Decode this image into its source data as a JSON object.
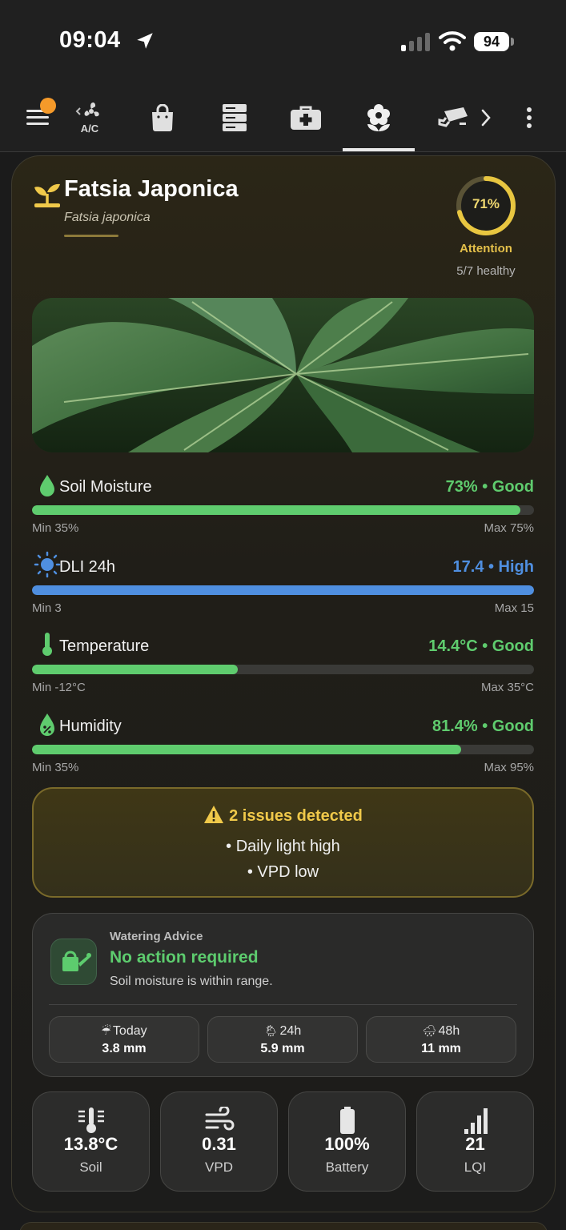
{
  "status_bar": {
    "time": "09:04",
    "battery": "94"
  },
  "tabs": [
    {
      "name": "menu",
      "icon": "hamburger-menu-icon"
    },
    {
      "name": "ac",
      "icon": "fan-icon",
      "label": "A/C"
    },
    {
      "name": "shopping",
      "icon": "shopping-bag-icon"
    },
    {
      "name": "server",
      "icon": "server-rack-icon"
    },
    {
      "name": "medical",
      "icon": "first-aid-kit-icon"
    },
    {
      "name": "plants",
      "icon": "flower-icon",
      "active": true
    },
    {
      "name": "cameras",
      "icon": "security-camera-icon"
    }
  ],
  "plant": {
    "name": "Fatsia Japonica",
    "latin": "Fatsia japonica",
    "health": {
      "percent": "71%",
      "fraction": 0.71,
      "state": "Attention",
      "count": "5/7 healthy"
    }
  },
  "metrics": [
    {
      "key": "soil",
      "label": "Soil Moisture",
      "value": "73% • Good",
      "color": "#5fcc6e",
      "fill": 0.973,
      "min": "Min 35%",
      "max": "Max 75%",
      "icon": "water-drop-icon"
    },
    {
      "key": "dli",
      "label": "DLI 24h",
      "value": "17.4 • High",
      "color": "#4f8fe0",
      "fill": 1.0,
      "min": "Min 3",
      "max": "Max 15",
      "icon": "sun-icon"
    },
    {
      "key": "temp",
      "label": "Temperature",
      "value": "14.4°C • Good",
      "color": "#5fcc6e",
      "fill": 0.41,
      "min": "Min -12°C",
      "max": "Max 35°C",
      "icon": "thermometer-icon"
    },
    {
      "key": "humidity",
      "label": "Humidity",
      "value": "81.4% • Good",
      "color": "#5fcc6e",
      "fill": 0.855,
      "min": "Min 35%",
      "max": "Max 95%",
      "icon": "humidity-drop-icon"
    }
  ],
  "issues": {
    "title": "2 issues detected",
    "items": [
      "• Daily light high",
      "• VPD low"
    ]
  },
  "watering": {
    "kicker": "Watering Advice",
    "title": "No action required",
    "desc": "Soil moisture is within range.",
    "forecast": [
      {
        "period": "Today",
        "amount": "3.8 mm",
        "icon": "☔"
      },
      {
        "period": "24h",
        "amount": "5.9 mm",
        "icon": "🌦"
      },
      {
        "period": "48h",
        "amount": "11 mm",
        "icon": "🌧"
      }
    ]
  },
  "tiles": [
    {
      "value": "13.8°C",
      "label": "Soil",
      "icon": "soil-thermometer-icon"
    },
    {
      "value": "0.31",
      "label": "VPD",
      "icon": "wind-icon"
    },
    {
      "value": "100%",
      "label": "Battery",
      "icon": "battery-icon"
    },
    {
      "value": "21",
      "label": "LQI",
      "icon": "signal-bars-icon"
    }
  ]
}
